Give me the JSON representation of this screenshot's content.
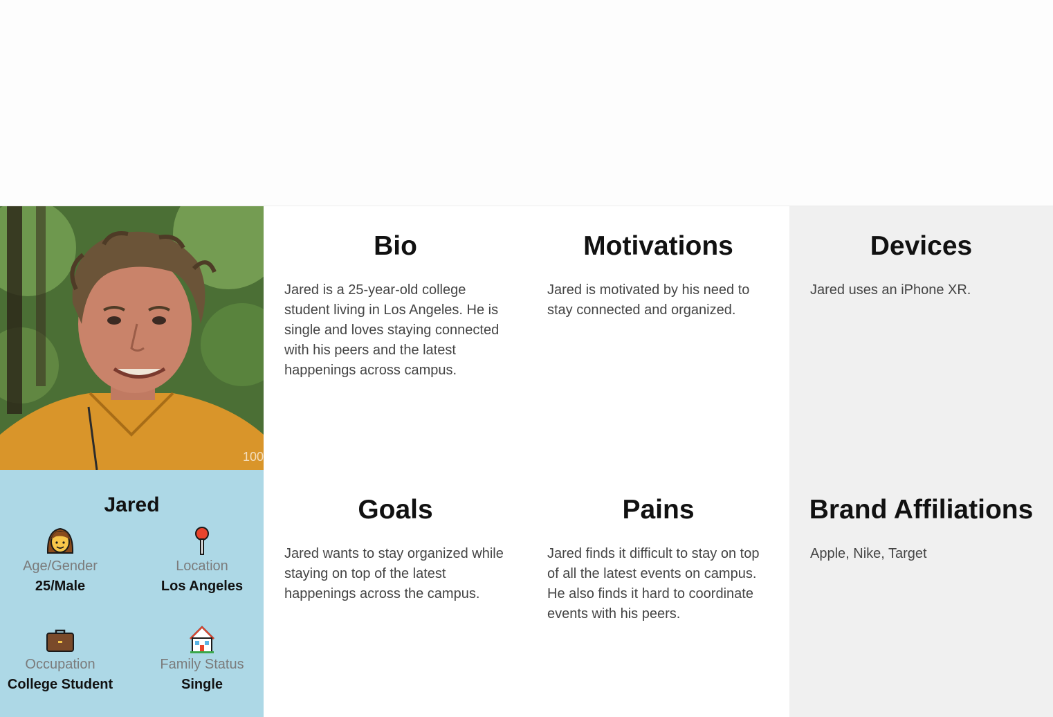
{
  "photo": {
    "caption": "100"
  },
  "profile": {
    "name": "Jared",
    "stats": [
      {
        "icon": "woman-icon",
        "label": "Age/Gender",
        "value": "25/Male"
      },
      {
        "icon": "pushpin-icon",
        "label": "Location",
        "value": "Los Angeles"
      },
      {
        "icon": "briefcase-icon",
        "label": "Occupation",
        "value": "College Student"
      },
      {
        "icon": "house-icon",
        "label": "Family Status",
        "value": "Single"
      }
    ]
  },
  "sections": {
    "bio": {
      "title": "Bio",
      "text": "Jared is a 25-year-old college student living in Los Angeles. He is single and loves staying connected with his peers and the latest happenings across campus."
    },
    "motivations": {
      "title": "Motivations",
      "text": "Jared is motivated by his need to stay connected and organized."
    },
    "devices": {
      "title": "Devices",
      "text": "Jared uses an iPhone XR."
    },
    "goals": {
      "title": "Goals",
      "text": "Jared wants to stay organized while staying on top of the latest happenings across the campus."
    },
    "pains": {
      "title": "Pains",
      "text": "Jared finds it difficult to stay on top of all the latest events on campus. He also finds it hard to coordinate events with his peers."
    },
    "brand_affiliations": {
      "title": "Brand Affiliations",
      "text": "Apple, Nike, Target"
    }
  },
  "colors": {
    "profile_bg": "#add8e6",
    "grey_column": "#f0f0f0",
    "shirt": "#d9952a"
  }
}
